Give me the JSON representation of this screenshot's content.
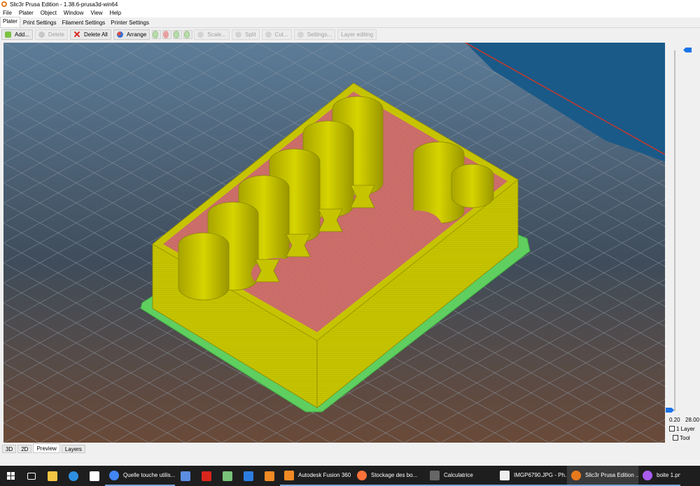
{
  "window": {
    "title": "Slic3r Prusa Edition - 1.38.6-prusa3d-win64"
  },
  "menu": [
    "File",
    "Plater",
    "Object",
    "Window",
    "View",
    "Help"
  ],
  "tabs": [
    "Plater",
    "Print Settings",
    "Filament Settings",
    "Printer Settings"
  ],
  "toolbar": {
    "add": "Add...",
    "delete": "Delete",
    "delete_all": "Delete All",
    "arrange": "Arrange",
    "scale": "Scale...",
    "split": "Split",
    "cut": "Cut...",
    "settings": "Settings...",
    "layer_editing": "Layer editing"
  },
  "side": {
    "min_height": "0.20",
    "max_height": "28.00",
    "one_layer": "1 Layer",
    "tool": "Tool"
  },
  "bottom_tabs": [
    "3D",
    "2D",
    "Preview",
    "Layers"
  ],
  "taskbar": {
    "apps": [
      {
        "label": "Quelle touche utilis...",
        "color": "#4285f4"
      },
      {
        "label": "Autodesk Fusion 360",
        "color": "#f08a24"
      },
      {
        "label": "Stockage des bo...",
        "color": "#ff7139"
      },
      {
        "label": "Calculatrice",
        "color": "#555555"
      },
      {
        "label": "IMGP6790.JPG - Ph...",
        "color": "#ffffff"
      },
      {
        "label": "Slic3r Prusa Edition ...",
        "color": "#e8791c"
      },
      {
        "label": "boite 1.png",
        "color": "#a85cf0"
      }
    ]
  },
  "colors": {
    "wall": "#c6c400",
    "floor": "#c96a68",
    "skirt": "#5fcf5f",
    "bed_grid": "#7a8a9a"
  }
}
